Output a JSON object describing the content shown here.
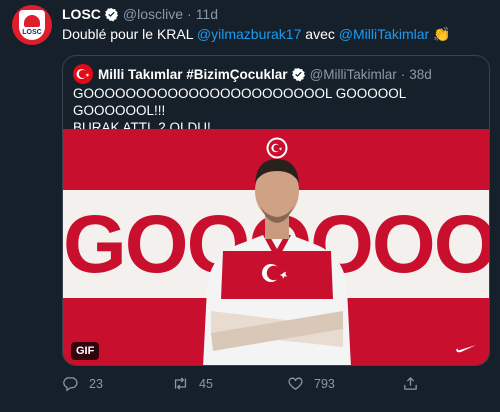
{
  "tweet": {
    "author_name": "LOSC",
    "handle": "@losclive",
    "separator": "·",
    "time": "11d",
    "avatar_text": "LOSC",
    "text_prefix": "Doublé pour le KRAL ",
    "mention_1": "@yilmazburak17",
    "text_middle": " avec ",
    "mention_2": "@MilliTakimlar",
    "emoji": "👏"
  },
  "quote": {
    "author_name": "Milli Takımlar #BizimÇocuklar",
    "handle": "@MilliTakimlar",
    "separator": "·",
    "time": "38d",
    "text_line_1": "GOOOOOOOOOOOOOOOOOOOOOOOL GOOOOOL GOOOOOOL!!!",
    "text_line_2": "BURAK ATTI, 2 OLDU!",
    "media_text": "GOOOOOOOL",
    "gif_label": "GIF"
  },
  "actions": {
    "reply_count": "23",
    "retweet_count": "45",
    "like_count": "793"
  },
  "colors": {
    "background": "#15202b",
    "link": "#1d9bf0",
    "muted": "#8b98a5",
    "border": "#38444d",
    "turkey_red": "#c8102e",
    "losc_red": "#e01e2b"
  }
}
